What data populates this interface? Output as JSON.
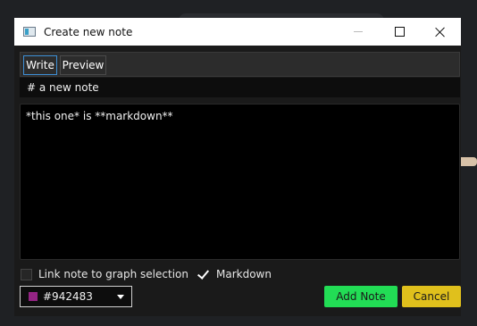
{
  "window": {
    "title": "Create new note",
    "icon": "app-icon",
    "controls": [
      "minimize-icon",
      "maximize-icon",
      "close-icon"
    ]
  },
  "tabs": [
    {
      "label": "Write",
      "active": true
    },
    {
      "label": "Preview",
      "active": false
    }
  ],
  "note": {
    "title_value": "# a new note",
    "body_value": "*this one* is **markdown**"
  },
  "options": {
    "link_graph": {
      "label": "Link note to graph selection",
      "checked": false
    },
    "markdown": {
      "label": "Markdown",
      "checked": true
    }
  },
  "color_select": {
    "value": "#942483",
    "swatch_color": "#942483"
  },
  "buttons": {
    "add_label": "Add Note",
    "cancel_label": "Cancel"
  },
  "colors": {
    "add_button": "#22dd55",
    "cancel_button": "#e0c01c",
    "active_tab_border": "#3d8fd6"
  }
}
